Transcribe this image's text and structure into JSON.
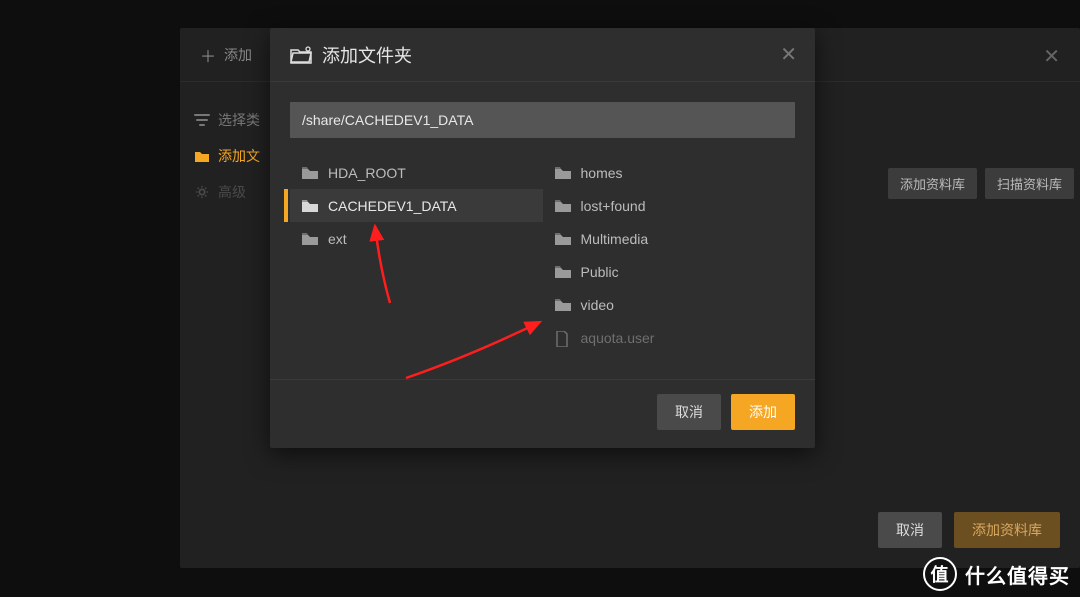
{
  "outer": {
    "title_prefix": "添加",
    "close_glyph": "✕",
    "side": [
      {
        "icon": "filter-icon",
        "label": "选择类"
      },
      {
        "icon": "folder-icon",
        "label": "添加文",
        "active": true
      },
      {
        "icon": "gear-icon",
        "label": "高级"
      }
    ],
    "right_buttons": [
      "添加资料库",
      "扫描资料库"
    ],
    "footer_cancel": "取消",
    "footer_confirm": "添加资料库"
  },
  "dialog": {
    "title": "添加文件夹",
    "close_glyph": "✕",
    "path_value": "/share/CACHEDEV1_DATA",
    "left_col": [
      {
        "name": "HDA_ROOT",
        "type": "folder",
        "selected": false
      },
      {
        "name": "CACHEDEV1_DATA",
        "type": "folder",
        "selected": true
      },
      {
        "name": "ext",
        "type": "folder",
        "selected": false
      }
    ],
    "right_col": [
      {
        "name": "homes",
        "type": "folder"
      },
      {
        "name": "lost+found",
        "type": "folder"
      },
      {
        "name": "Multimedia",
        "type": "folder"
      },
      {
        "name": "Public",
        "type": "folder"
      },
      {
        "name": "video",
        "type": "folder"
      },
      {
        "name": "aquota.user",
        "type": "file"
      }
    ],
    "cancel": "取消",
    "confirm": "添加"
  },
  "watermark": {
    "badge": "值",
    "text": "什么值得买"
  }
}
